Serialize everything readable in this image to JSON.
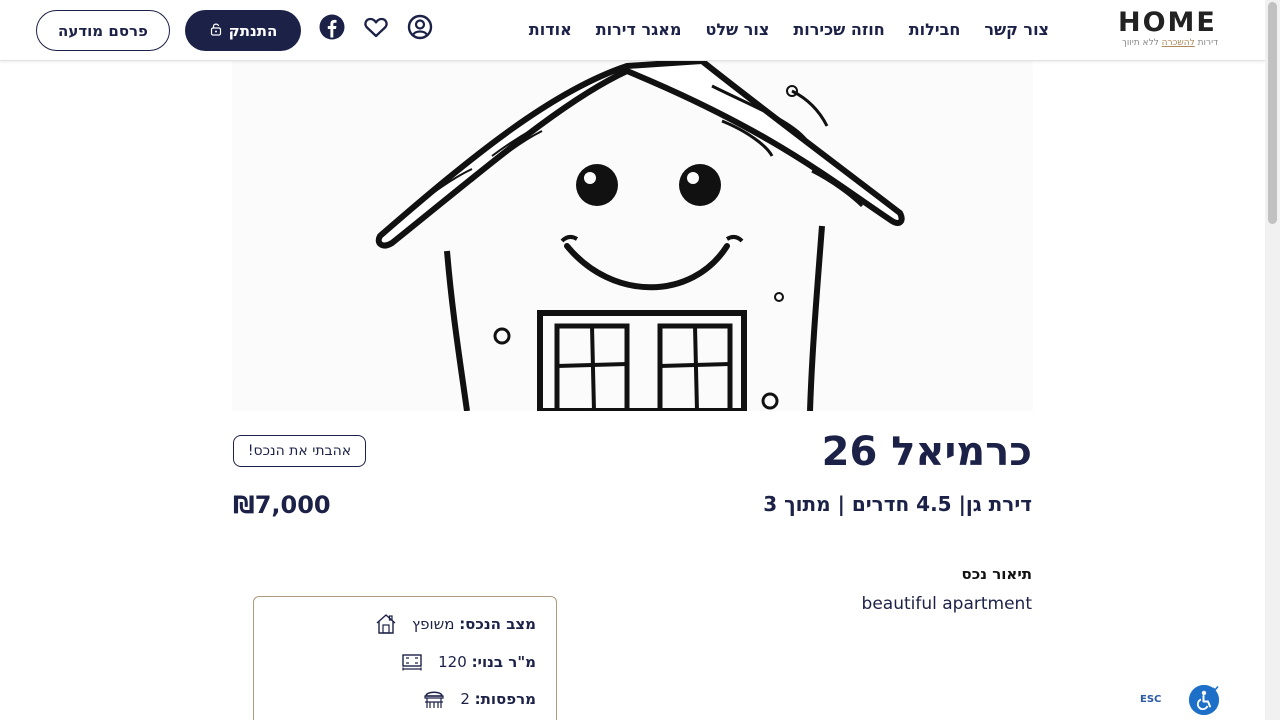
{
  "brand": {
    "logo_text": "HOME",
    "tagline_prefix": "דירות ",
    "tagline_highlight": "להשכרה",
    "tagline_suffix": " ללא תיווך"
  },
  "nav": {
    "items": [
      {
        "label": "אודות"
      },
      {
        "label": "מאגר דירות"
      },
      {
        "label": "צור שלט"
      },
      {
        "label": "חוזה שכירות"
      },
      {
        "label": "חבילות"
      },
      {
        "label": "צור קשר"
      }
    ]
  },
  "header_actions": {
    "login_label": "התנתק",
    "publish_label": "פרסם מודעה"
  },
  "property": {
    "title": "כרמיאל 26",
    "subtitle": "דירת גן| 4.5 חדרים | מתוך 3",
    "price": "₪7,000",
    "love_label": "אהבתי את הנכס!",
    "description_title": "תיאור נכס",
    "description": "beautiful apartment"
  },
  "details": [
    {
      "icon": "house-condition-icon",
      "label": "מצב הנכס:",
      "value": " משופץ"
    },
    {
      "icon": "floor-area-icon",
      "label": "מ\"ר בנוי:",
      "value": " 120"
    },
    {
      "icon": "balcony-icon",
      "label": "מרפסות:",
      "value": " 2"
    }
  ],
  "accessibility": {
    "esc_label": "ESC"
  },
  "colors": {
    "primary": "#1c2147",
    "accent": "#b09a80",
    "a11y_blue": "#1d6fc7"
  }
}
